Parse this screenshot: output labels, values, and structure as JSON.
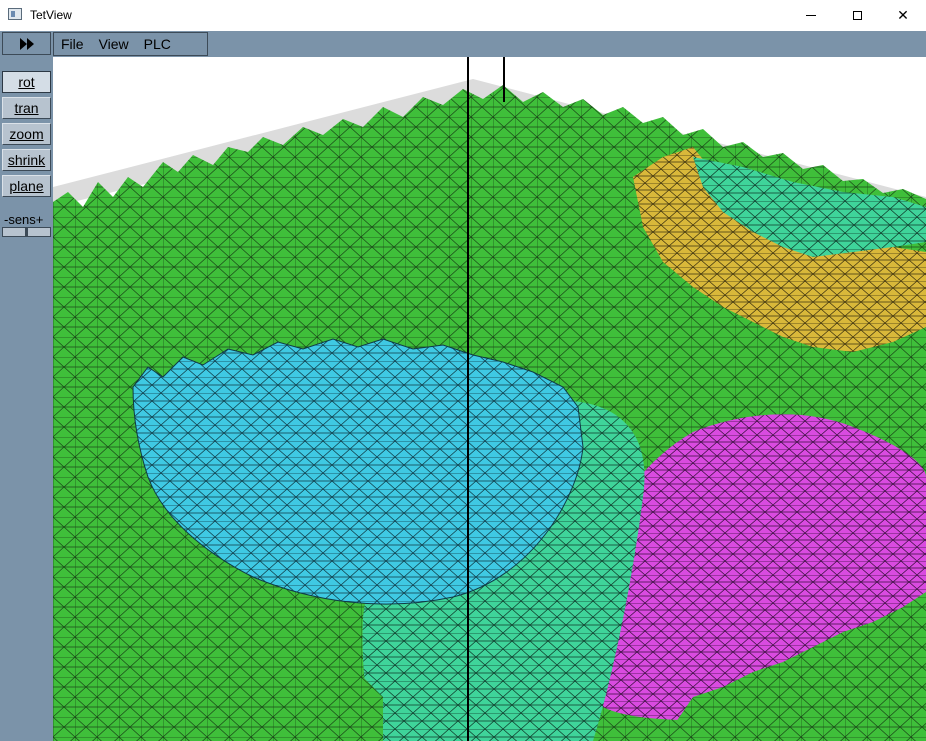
{
  "window": {
    "title": "TetView",
    "minimize_label": "",
    "close_symbol": "✕"
  },
  "toolbar": {
    "play_icon": "fast-forward-icon",
    "menus": [
      "File",
      "View",
      "PLC"
    ]
  },
  "tools": [
    {
      "label": "rot",
      "active": true
    },
    {
      "label": "tran",
      "active": false
    },
    {
      "label": "zoom",
      "active": false
    },
    {
      "label": "shrink",
      "active": false
    },
    {
      "label": "plane",
      "active": false
    }
  ],
  "sensitivity": {
    "label": "-sens+",
    "level": 0.5
  },
  "colors": {
    "background_green": "#3fbf3a",
    "cyan_region": "#3fd0e6",
    "teal_region": "#3fd49a",
    "magenta_region": "#d94be0",
    "gold_region": "#d9b83a",
    "panel": "#7b93a9"
  }
}
